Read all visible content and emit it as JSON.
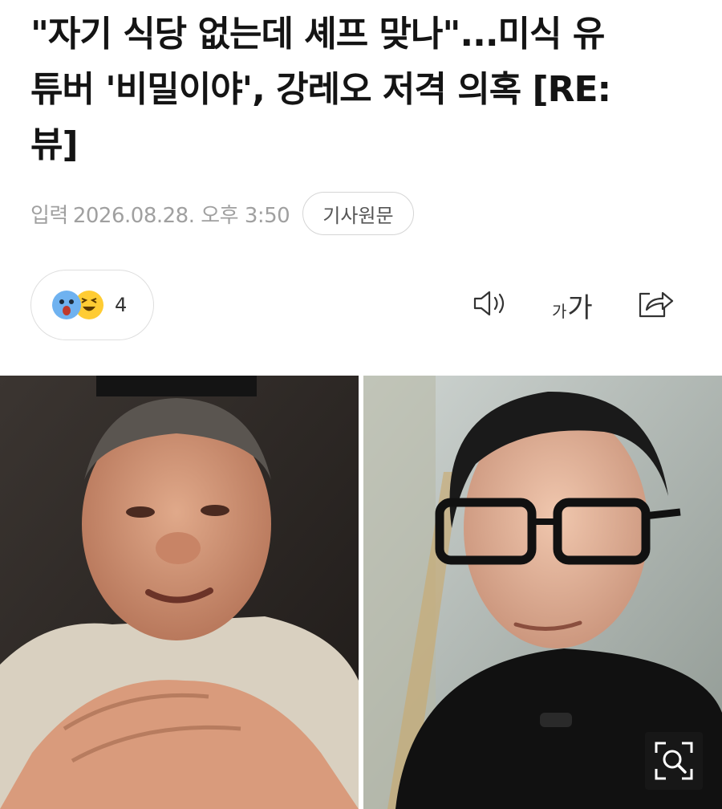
{
  "article": {
    "headline_lines": [
      "\"자기 식당 없는데 셰프 맞나\"...미식 유",
      "튜버 '비밀이야', 강레오 저격 의혹 [RE:",
      "뷰]"
    ],
    "meta_label": "입력",
    "datetime": "2026.08.28. 오후 3:50",
    "original_button": "기사원문"
  },
  "reactions": {
    "emojis": [
      "surprised-emoji",
      "laughing-emoji"
    ],
    "count": "4"
  },
  "toolbar": {
    "font_small": "가",
    "font_large": "가",
    "icons": [
      "speaker-icon",
      "font-size-icon",
      "share-icon"
    ]
  },
  "photo": {
    "description_icons": [
      "zoom-icon"
    ]
  },
  "colors": {
    "meta_gray": "#a0a0a0",
    "reaction_blue": "#6fb2f0",
    "reaction_yellow": "#ffcc33"
  }
}
